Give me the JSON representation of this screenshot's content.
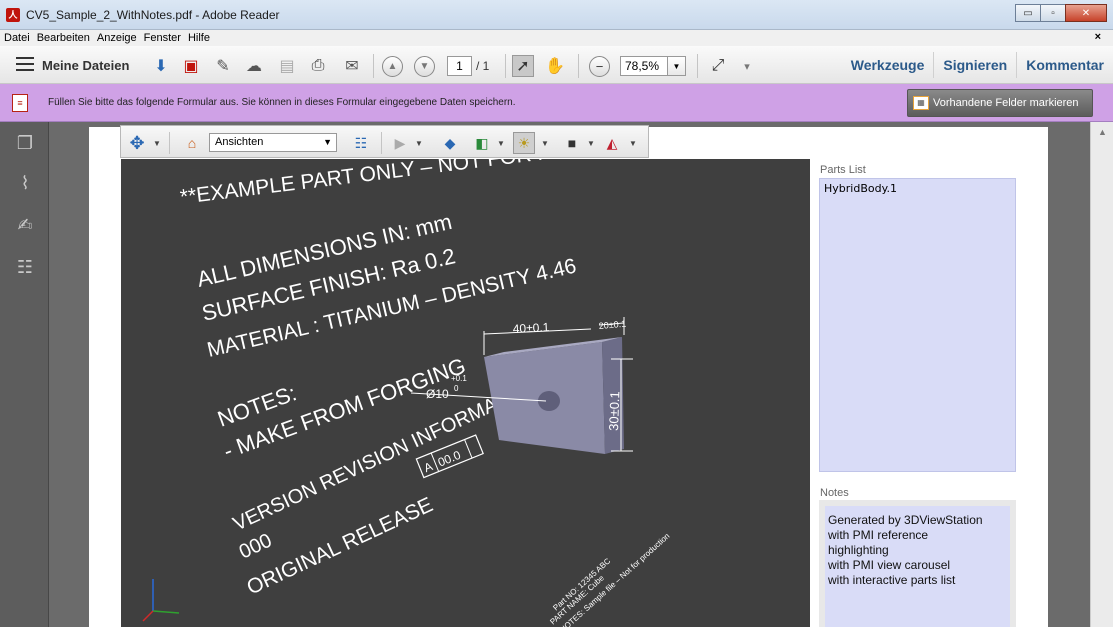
{
  "window": {
    "title": "CV5_Sample_2_WithNotes.pdf - Adobe Reader",
    "minimize_glyph": "▭",
    "maximize_glyph": "▫",
    "close_glyph": "✕"
  },
  "menu": {
    "items": [
      "Datei",
      "Bearbeiten",
      "Anzeige",
      "Fenster",
      "Hilfe"
    ],
    "close_glyph": "×"
  },
  "toolbar": {
    "my_files_label": "Meine Dateien",
    "page_current": "1",
    "page_total": "/ 1",
    "zoom_value": "78,5%",
    "tabs": [
      "Werkzeuge",
      "Signieren",
      "Kommentar"
    ]
  },
  "formbar": {
    "message": "Füllen Sie bitte das folgende Formular aus. Sie können in dieses Formular eingegebene Daten speichern.",
    "highlight_button": "Vorhandene Felder markieren"
  },
  "viewer3d": {
    "views_label": "Ansichten"
  },
  "drawing": {
    "line1": "**EXAMPLE PART ONLY – NOT FOR PRODUCTION**",
    "line2": "ALL DIMENSIONS IN: mm",
    "line3": "SURFACE FINISH: Ra 0.2",
    "line4": "MATERIAL : TITANIUM – DENSITY 4.46",
    "line5": "NOTES:",
    "line6": "- MAKE FROM FORGING",
    "line7": "VERSION REVISION INFORMATION",
    "line8": "000",
    "line9": "ORIGINAL RELEASE",
    "dim_width": "40±0.1",
    "dim_depth": "20±0.1",
    "dim_height": "30±0.1",
    "dim_hole": "Ø10",
    "dim_hole_tol_upper": "+0.1",
    "dim_hole_tol_lower": "0",
    "rev_box_letter": "A",
    "rev_box_value": "00.0",
    "title_block_1": "Part NO: 12345 ABC",
    "title_block_2": "PART NAME: Cube",
    "title_block_3": "NOTES: Sample file – Not for production"
  },
  "parts_list": {
    "label": "Parts List",
    "items": [
      "HybridBody.1"
    ]
  },
  "notes": {
    "label": "Notes",
    "lines": [
      "Generated by 3DViewStation",
      "with PMI reference",
      "highlighting",
      "with PMI view carousel",
      "with interactive parts list"
    ]
  }
}
